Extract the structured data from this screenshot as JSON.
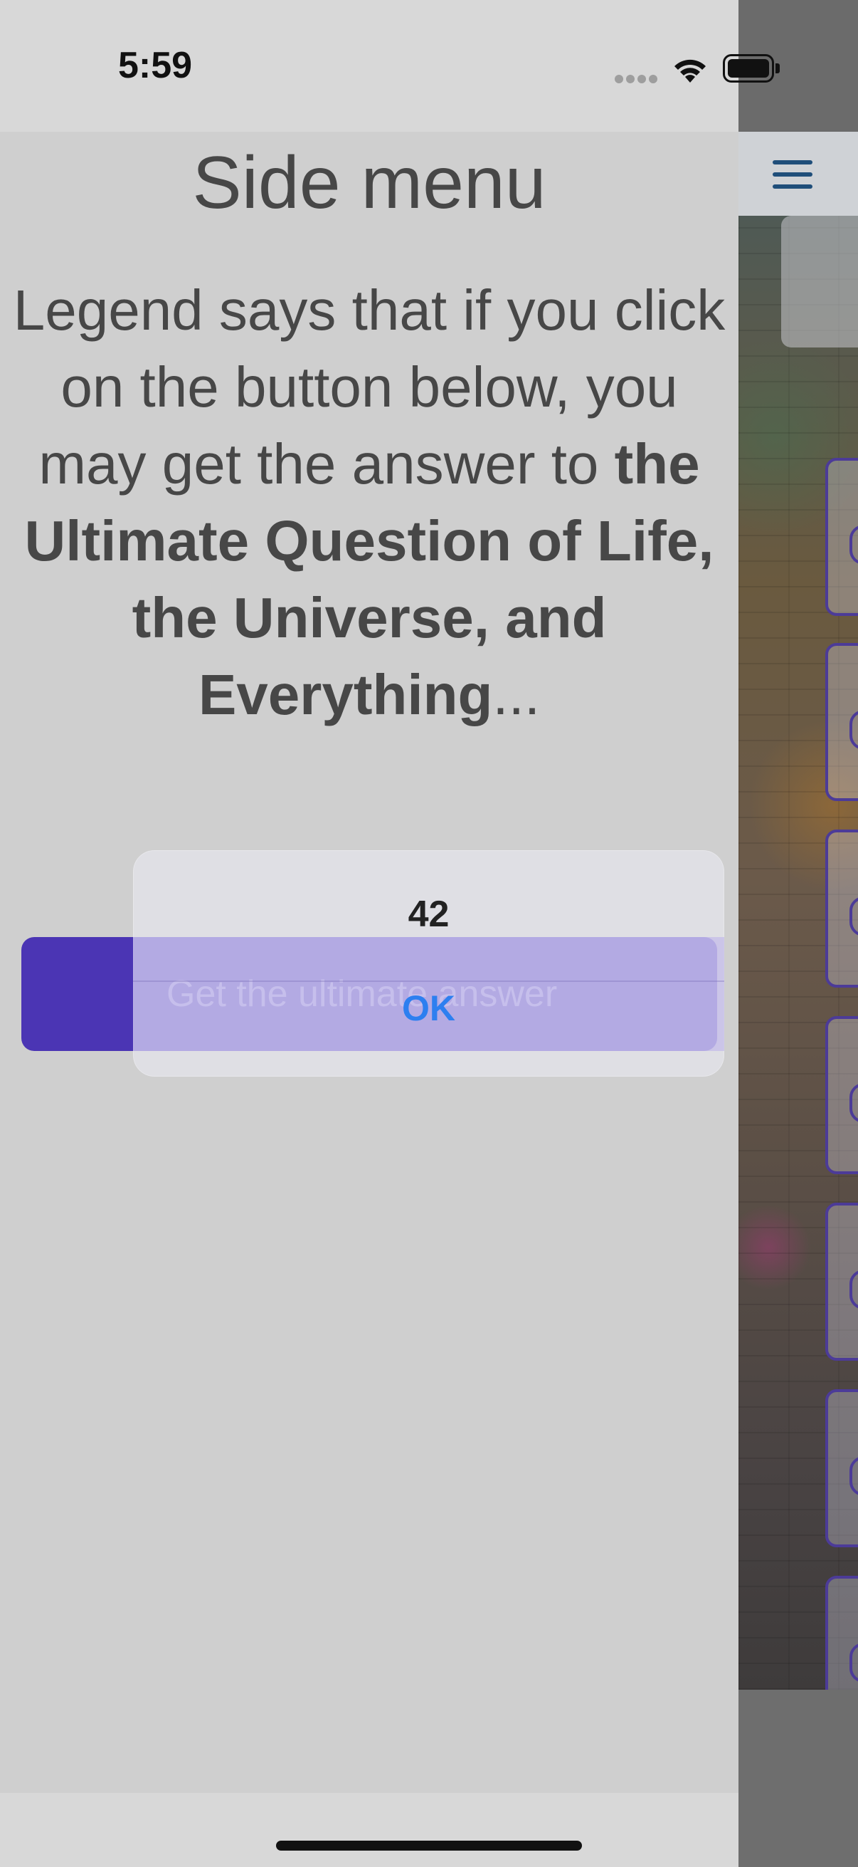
{
  "status_bar": {
    "time": "5:59"
  },
  "side_menu": {
    "title": "Side menu",
    "legend_intro": "Legend says that if you click on the button below, you may get the answer to ",
    "legend_bold": "the Ultimate Question of Life, the Universe, and Everything",
    "legend_tail": "...",
    "button_label": "Get the ultimate answer"
  },
  "alert": {
    "message": "42",
    "ok_label": "OK"
  },
  "icons": {
    "menu": "hamburger-menu-icon",
    "wifi": "wifi-icon",
    "battery": "battery-icon",
    "signal": "cellular-signal-icon"
  },
  "colors": {
    "button": "#4b35b4",
    "alert_ok": "#2d7ff0",
    "menu_icon": "#1f4e7a",
    "card_border": "#4c3b98"
  }
}
